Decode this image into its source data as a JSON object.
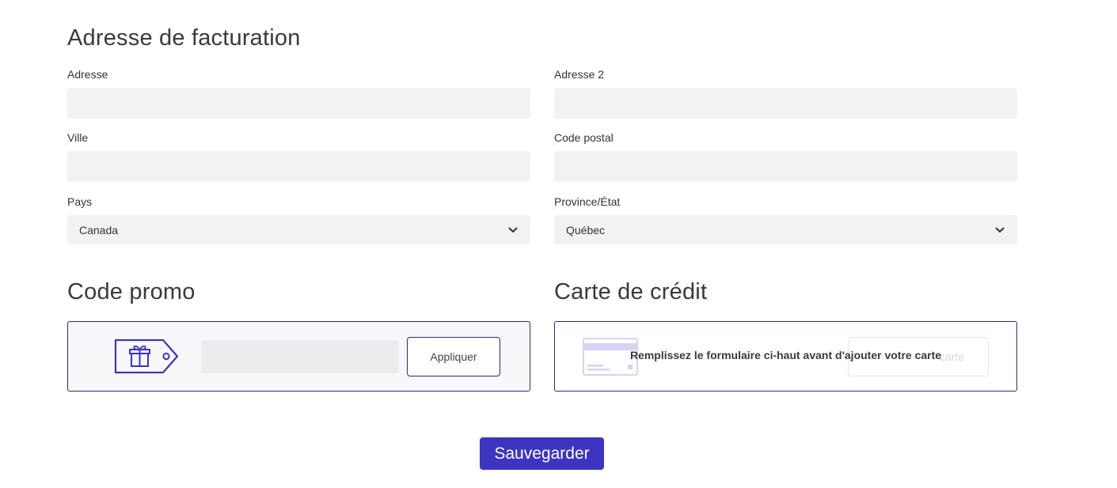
{
  "billing": {
    "title": "Adresse de facturation",
    "address": {
      "label": "Adresse",
      "value": ""
    },
    "address2": {
      "label": "Adresse 2",
      "value": ""
    },
    "city": {
      "label": "Ville",
      "value": ""
    },
    "postal": {
      "label": "Code postal",
      "value": ""
    },
    "country": {
      "label": "Pays",
      "selected": "Canada"
    },
    "province": {
      "label": "Province/État",
      "selected": "Québec"
    }
  },
  "promo": {
    "title": "Code promo",
    "input_value": "",
    "apply_label": "Appliquer",
    "icon": "gift-tag-icon"
  },
  "credit_card": {
    "title": "Carte de crédit",
    "overlay_message": "Remplissez le formulaire ci-haut avant d'ajouter votre carte",
    "ghost_button_label": "carte",
    "icon": "credit-card-icon"
  },
  "actions": {
    "save_label": "Sauvegarder"
  },
  "colors": {
    "accent": "#3c35c2",
    "border": "#2f2a6e",
    "input_bg": "#f2f2f2"
  }
}
